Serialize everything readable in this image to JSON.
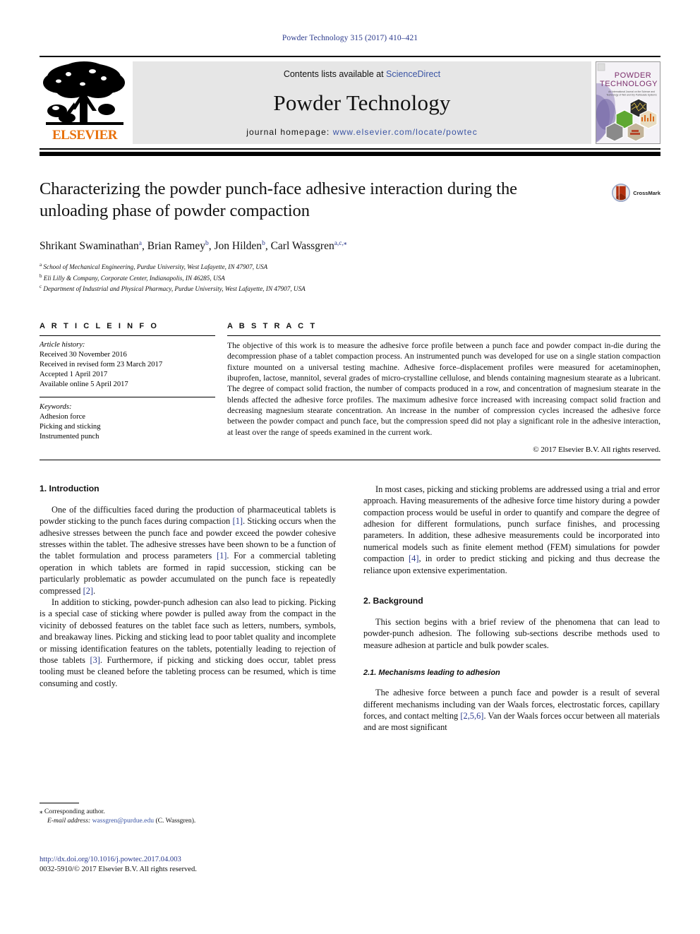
{
  "running_head": "Powder Technology 315 (2017) 410–421",
  "masthead": {
    "publisher_name": "ELSEVIER",
    "contents_prefix": "Contents lists available at ",
    "sciencedirect": "ScienceDirect",
    "journal_title": "Powder Technology",
    "homepage_prefix": "journal homepage: ",
    "homepage_url": "www.elsevier.com/locate/powtec",
    "cover_title_line1": "POWDER",
    "cover_title_line2": "TECHNOLOGY",
    "cover_subtitle": "An International Journal on the Science and Technology of Wet and Dry Particulate Systems"
  },
  "article": {
    "title": "Characterizing the powder punch-face adhesive interaction during the unloading phase of powder compaction",
    "crossmark_label": "CrossMark",
    "authors_html": "Shrikant Swaminathan<sup>a</sup>, Brian Ramey<sup>b</sup>, Jon Hilden<sup>b</sup>, Carl Wassgren<sup>a,c,</sup><sup>⁎</sup>",
    "affiliations": [
      {
        "marker": "a",
        "text": "School of Mechanical Engineering, Purdue University, West Lafayette, IN 47907, USA"
      },
      {
        "marker": "b",
        "text": "Eli Lilly & Company, Corporate Center, Indianapolis, IN 46285, USA"
      },
      {
        "marker": "c",
        "text": "Department of Industrial and Physical Pharmacy, Purdue University, West Lafayette, IN 47907, USA"
      }
    ]
  },
  "article_info": {
    "heading": "A R T I C L E   I N F O",
    "history_label": "Article history:",
    "history": [
      "Received 30 November 2016",
      "Received in revised form 23 March 2017",
      "Accepted 1 April 2017",
      "Available online 5 April 2017"
    ],
    "keywords_label": "Keywords:",
    "keywords": [
      "Adhesion force",
      "Picking and sticking",
      "Instrumented punch"
    ]
  },
  "abstract": {
    "heading": "A B S T R A C T",
    "text": "The objective of this work is to measure the adhesive force profile between a punch face and powder compact in-die during the decompression phase of a tablet compaction process. An instrumented punch was developed for use on a single station compaction fixture mounted on a universal testing machine. Adhesive force–displacement profiles were measured for acetaminophen, ibuprofen, lactose, mannitol, several grades of micro-crystalline cellulose, and blends containing magnesium stearate as a lubricant. The degree of compact solid fraction, the number of compacts produced in a row, and concentration of magnesium stearate in the blends affected the adhesive force profiles. The maximum adhesive force increased with increasing compact solid fraction and decreasing magnesium stearate concentration. An increase in the number of compression cycles increased the adhesive force between the powder compact and punch face, but the compression speed did not play a significant role in the adhesive interaction, at least over the range of speeds examined in the current work.",
    "copyright": "© 2017 Elsevier B.V. All rights reserved."
  },
  "body": {
    "left": {
      "section1_heading": "1. Introduction",
      "para1_parts": [
        "One of the difficulties faced during the production of pharmaceutical tablets is powder sticking to the punch faces during compaction ",
        "[1]",
        ". Sticking occurs when the adhesive stresses between the punch face and powder exceed the powder cohesive stresses within the tablet. The adhesive stresses have been shown to be a function of the tablet formulation and process parameters ",
        "[1]",
        ". For a commercial tableting operation in which tablets are formed in rapid succession, sticking can be particularly problematic as powder accumulated on the punch face is repeatedly compressed ",
        "[2]",
        "."
      ],
      "para2_parts": [
        "In addition to sticking, powder-punch adhesion can also lead to picking. Picking is a special case of sticking where powder is pulled away from the compact in the vicinity of debossed features on the tablet face such as letters, numbers, symbols, and breakaway lines. Picking and sticking lead to poor tablet quality and incomplete or missing identification features on the tablets, potentially leading to rejection of those tablets ",
        "[3]",
        ". Furthermore, if picking and sticking does occur, tablet press tooling must be cleaned before the tableting process can be resumed, which is time consuming and costly."
      ]
    },
    "right": {
      "para1_parts": [
        "In most cases, picking and sticking problems are addressed using a trial and error approach. Having measurements of the adhesive force time history during a powder compaction process would be useful in order to quantify and compare the degree of adhesion for different formulations, punch surface finishes, and processing parameters. In addition, these adhesive measurements could be incorporated into numerical models such as finite element method (FEM) simulations for powder compaction ",
        "[4]",
        ", in order to predict sticking and picking and thus decrease the reliance upon extensive experimentation."
      ],
      "section2_heading": "2. Background",
      "para2": "This section begins with a brief review of the phenomena that can lead to powder-punch adhesion. The following sub-sections describe methods used to measure adhesion at particle and bulk powder scales.",
      "subsection21_heading": "2.1. Mechanisms leading to adhesion",
      "para3_parts": [
        "The adhesive force between a punch face and powder is a result of several different mechanisms including van der Waals forces, electrostatic forces, capillary forces, and contact melting ",
        "[2,5,6]",
        ". Van der Waals forces occur between all materials and are most significant"
      ]
    }
  },
  "footnote": {
    "star": "⁎",
    "corresponding": "Corresponding author.",
    "email_label": "E-mail address:",
    "email": "wassgren@purdue.edu",
    "email_suffix": "(C. Wassgren)."
  },
  "footer": {
    "doi": "http://dx.doi.org/10.1016/j.powtec.2017.04.003",
    "issn_line": "0032-5910/© 2017 Elsevier B.V. All rights reserved."
  },
  "colors": {
    "link_blue": "#3a54a4",
    "ref_blue": "#2b3a8c",
    "elsevier_orange": "#e8700a",
    "masthead_grey": "#e6e6e6"
  }
}
